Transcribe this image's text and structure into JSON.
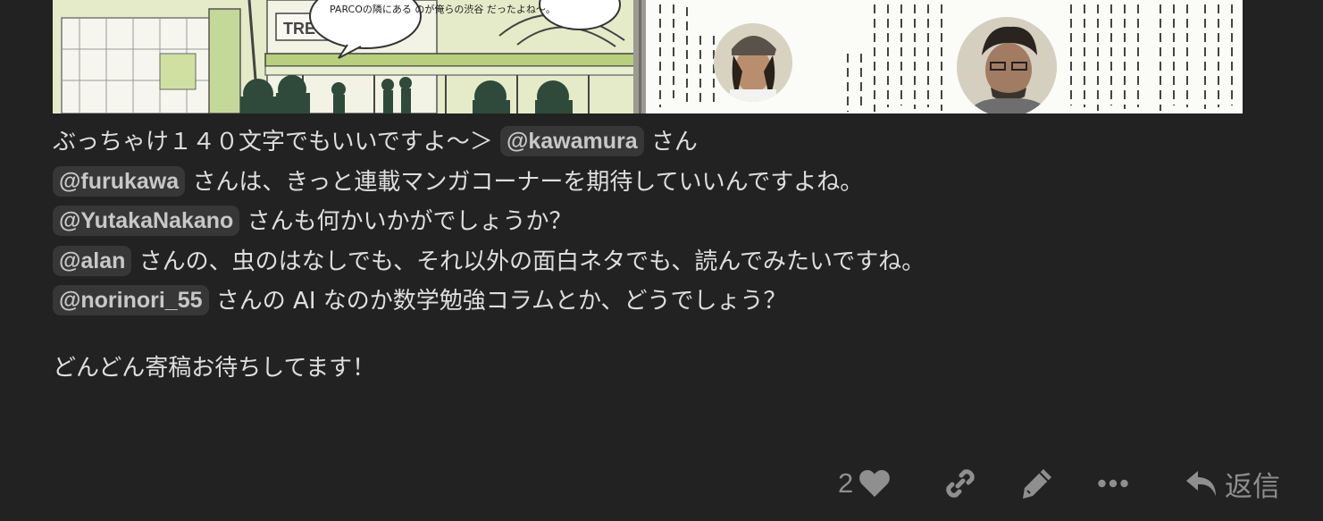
{
  "post": {
    "lines": [
      [
        {
          "type": "text",
          "value": "ぶっちゃけ１４０文字でもいいですよ〜＞ "
        },
        {
          "type": "mention",
          "value": "@kawamura"
        },
        {
          "type": "text",
          "value": " さん"
        }
      ],
      [
        {
          "type": "mention",
          "value": "@furukawa"
        },
        {
          "type": "text",
          "value": " さんは、きっと連載マンガコーナーを期待していいんですよね。"
        }
      ],
      [
        {
          "type": "mention",
          "value": "@YutakaNakano"
        },
        {
          "type": "text",
          "value": " さんも何かいかがでしょうか？"
        }
      ],
      [
        {
          "type": "mention",
          "value": "@alan"
        },
        {
          "type": "text",
          "value": " さんの、虫のはなしでも、それ以外の面白ネタでも、読んでみたいですね。"
        }
      ],
      [
        {
          "type": "mention",
          "value": "@norinori_55"
        },
        {
          "type": "text",
          "value": " さんの AI なのか数学勉強コラムとか、どうでしょう？"
        }
      ]
    ],
    "closing": "どんどん寄稿お待ちしてます！",
    "image_text": {
      "bubble": "PARCOの隣にある のが俺らの渋谷 だったよね〜。",
      "sign": "TRE"
    }
  },
  "actions": {
    "like_count": "2",
    "reply_label": "返信",
    "icons": [
      "heart-icon",
      "link-icon",
      "pencil-icon",
      "ellipsis-icon",
      "reply-icon"
    ]
  },
  "colors": {
    "background": "#222222",
    "text": "#dedede",
    "mention_bg": "#373737",
    "muted": "#8f8f8f"
  }
}
